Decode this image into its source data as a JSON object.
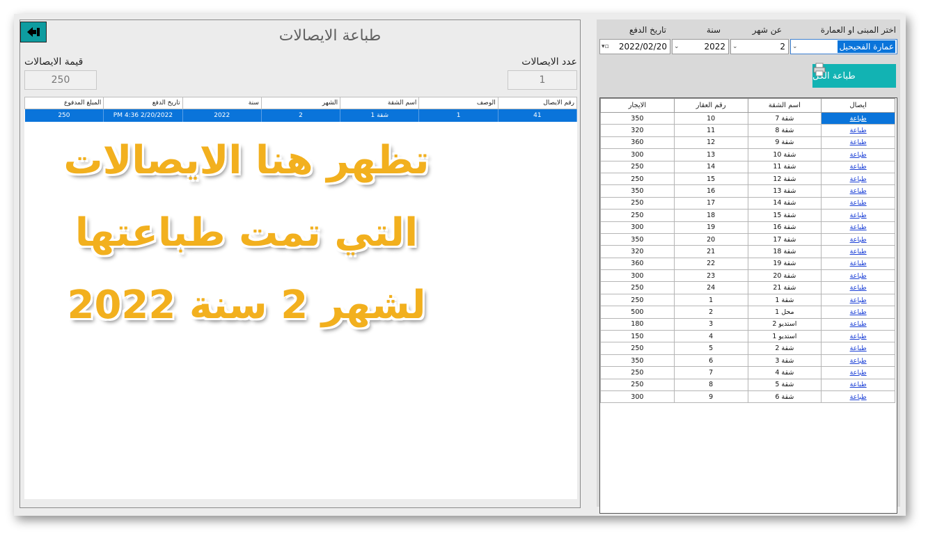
{
  "left": {
    "title": "طباعة الايصالات",
    "count_label": "عدد الايصالات",
    "count_value": "1",
    "value_label": "قيمة الايصالات",
    "value_value": "250",
    "columns": [
      "رقم الايصال",
      "الوصف",
      "اسم الشقة",
      "الشهر",
      "سنة",
      "تاريخ الدفع",
      "المبلغ المدفوع"
    ],
    "rows": [
      [
        "41",
        "1",
        "شقة 1",
        "2",
        "2022",
        "2/20/2022 4:36 PM",
        "250"
      ]
    ],
    "overlay": [
      "تظهر هنا الايصالات",
      "التي تمت طباعتها",
      "لشهر 2 سنة 2022"
    ]
  },
  "right": {
    "building_label": "اختر المبنى او العمارة",
    "building_value": "عمارة الفحيحيل",
    "month_label": "عن شهر",
    "month_value": "2",
    "year_label": "سنة",
    "year_value": "2022",
    "date_label": "تاريخ الدفع",
    "date_value": "2022/02/20",
    "print_all_label": "طباعة الكل",
    "columns": [
      "ايصال",
      "اسم الشقة",
      "رقم العقار",
      "الايجار"
    ],
    "link_text": "طباعة",
    "rows": [
      [
        "شقة 7",
        "10",
        "350"
      ],
      [
        "شقة 8",
        "11",
        "320"
      ],
      [
        "شقة 9",
        "12",
        "360"
      ],
      [
        "شقة 10",
        "13",
        "300"
      ],
      [
        "شقة 11",
        "14",
        "250"
      ],
      [
        "شقة 12",
        "15",
        "250"
      ],
      [
        "شقة 13",
        "16",
        "350"
      ],
      [
        "شقة 14",
        "17",
        "250"
      ],
      [
        "شقة 15",
        "18",
        "250"
      ],
      [
        "شقة 16",
        "19",
        "300"
      ],
      [
        "شقة 17",
        "20",
        "350"
      ],
      [
        "شقة 18",
        "21",
        "320"
      ],
      [
        "شقة 19",
        "22",
        "360"
      ],
      [
        "شقة 20",
        "23",
        "300"
      ],
      [
        "شقة 21",
        "24",
        "250"
      ],
      [
        "شقة 1",
        "1",
        "250"
      ],
      [
        "محل 1",
        "2",
        "500"
      ],
      [
        "استديو 2",
        "3",
        "180"
      ],
      [
        "استديو 1",
        "4",
        "150"
      ],
      [
        "شقة 2",
        "5",
        "250"
      ],
      [
        "شقة 3",
        "6",
        "350"
      ],
      [
        "شقة 4",
        "7",
        "250"
      ],
      [
        "شقة 5",
        "8",
        "250"
      ],
      [
        "شقة 6",
        "9",
        "300"
      ]
    ]
  },
  "colors": {
    "accent": "#0e9ca0",
    "selection": "#0a74da",
    "overlay_text": "#f2b01e"
  }
}
